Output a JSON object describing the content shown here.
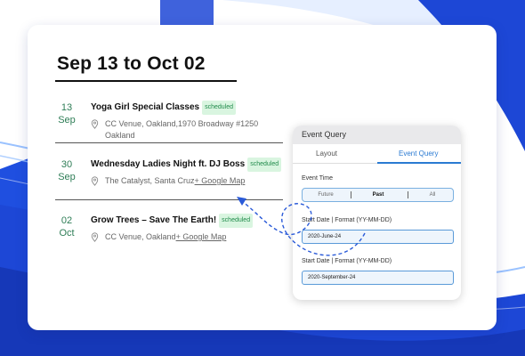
{
  "header": {
    "date_range": "Sep 13 to Oct 02"
  },
  "events": [
    {
      "day": "13",
      "month": "Sep",
      "title": "Yoga Girl Special Classes",
      "badge": "scheduled",
      "location": "CC Venue, Oakland,1970 Broadway #1250 Oakland",
      "map_link": ""
    },
    {
      "day": "30",
      "month": "Sep",
      "title": "Wednesday Ladies Night ft. DJ Boss",
      "badge": "scheduled",
      "location": "The Catalyst, Santa Cruz",
      "map_link": "+ Google Map"
    },
    {
      "day": "02",
      "month": "Oct",
      "title": "Grow Trees – Save The Earth!",
      "badge": "scheduled",
      "location": "CC Venue, Oakland",
      "map_link": "+ Google Map"
    }
  ],
  "panel": {
    "title": "Event Query",
    "tabs": [
      "Layout",
      "Event Query"
    ],
    "active_tab": "Event Query",
    "event_time_label": "Event Time",
    "event_time_options": [
      "Future",
      "Past",
      "All"
    ],
    "event_time_selected": "Past",
    "start_date_label": "Start Date | Format (YY-MM-DD)",
    "start_date_value": "2020-June-24",
    "end_date_label": "Start Date | Format (YY-MM-DD)",
    "end_date_value": "2020-September-24"
  },
  "colors": {
    "accent": "#2a7ad2",
    "date_green": "#2e7d56",
    "badge_bg": "#d9f5e0",
    "badge_text": "#1f8a4a",
    "background_blue": "#1d47d6"
  },
  "icons": {
    "location": "map-pin-icon",
    "connector": "dashed-arrow-icon"
  }
}
